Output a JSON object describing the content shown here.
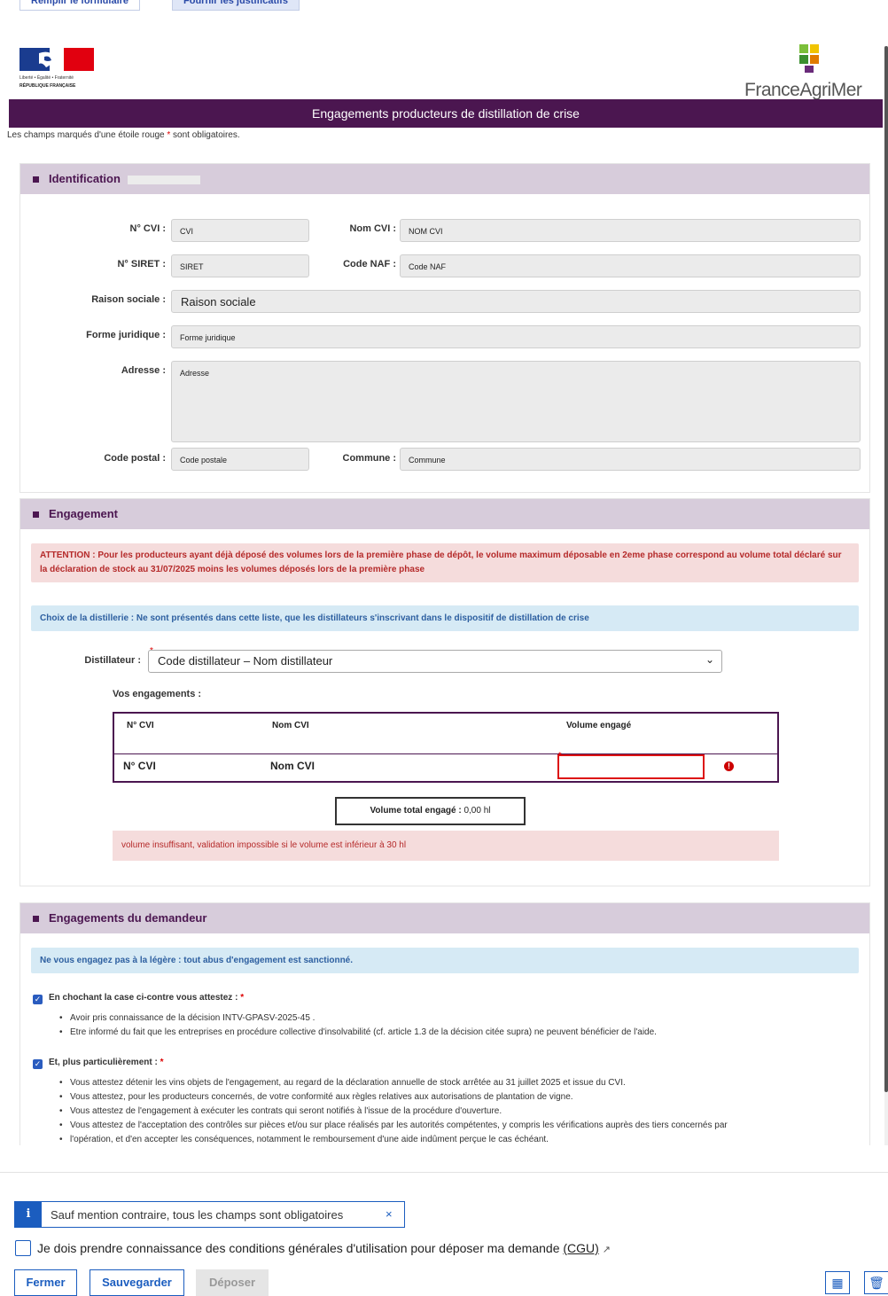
{
  "top_tabs": [
    "Remplir le formulaire",
    "Fournir les justificatifs"
  ],
  "header": {
    "title": "Engagements producteurs de distillation de crise",
    "required_note": "Les champs marqués d'une étoile rouge",
    "required_note_suffix": "sont obligatoires.",
    "logo_left_lines": [
      "Liberté • Égalité • Fraternité",
      "RÉPUBLIQUE FRANÇAISE"
    ],
    "logo_right_text": "FranceAgriMer"
  },
  "identification": {
    "heading": "Identification",
    "labels": {
      "cvi": "N° CVI :",
      "nom_cvi": "Nom CVI :",
      "siret": "N° SIRET :",
      "code_naf": "Code NAF :",
      "raison": "Raison sociale :",
      "forme": "Forme juridique :",
      "adresse": "Adresse :",
      "cp": "Code postal :",
      "commune": "Commune :"
    },
    "values": {
      "cvi": "CVI",
      "nom_cvi": "NOM CVI",
      "siret": "SIRET",
      "code_naf": "Code NAF",
      "raison": "Raison sociale",
      "forme": "Forme juridique",
      "adresse": "Adresse",
      "cp": "Code postale",
      "commune": "Commune"
    }
  },
  "engagement": {
    "heading": "Engagement",
    "attention": "ATTENTION : Pour les producteurs ayant déjà déposé des volumes lors de la première phase de dépôt, le volume maximum déposable en 2eme phase correspond au volume total déclaré sur la déclaration de stock au 31/07/2025 moins les volumes déposés lors de la première phase",
    "choix": "Choix de la distillerie : Ne sont présentés dans cette liste, que les distillateurs s'inscrivant dans le dispositif de distillation de crise",
    "distillateur_label": "Distillateur :",
    "distillateur_value": "Code distillateur – Nom distillateur",
    "vos_engagements": "Vos engagements :",
    "table_headers": [
      "N° CVI",
      "Nom CVI",
      "Volume engagé"
    ],
    "row": {
      "cvi": "N° CVI",
      "nom": "Nom CVI",
      "volume": ""
    },
    "total_label": "Volume total engagé :",
    "total_value": "0,00 hl",
    "insufficient": "volume insuffisant, validation impossible si le volume est inférieur à 30 hl"
  },
  "demandeur": {
    "heading": "Engagements du demandeur",
    "warning": "Ne vous engagez pas à la légère : tout abus d'engagement est sanctionné.",
    "check1_label": "En chochant la case ci-contre vous attestez :",
    "check1_items": [
      "Avoir pris connaissance de la décision INTV-GPASV-2025-45 .",
      "Etre informé du fait que les entreprises en procédure collective d'insolvabilité (cf. article 1.3 de la décision citée supra) ne peuvent bénéficier de l'aide."
    ],
    "check2_label": "Et, plus particulièrement :",
    "check2_items": [
      "Vous attestez détenir les vins objets de l'engagement, au regard de la déclaration annuelle de stock arrêtée au 31 juillet 2025 et issue du CVI.",
      "Vous attestez, pour les producteurs concernés, de votre conformité aux règles relatives aux autorisations de plantation de vigne.",
      "Vous attestez de l'engagement à exécuter les contrats qui seront notifiés à l'issue de la procédure d'ouverture.",
      "Vous attestez de l'acceptation des contrôles sur pièces et/ou sur place réalisés par les autorités compétentes, y compris les vérifications auprès des tiers concernés par",
      "l'opération, et d'en accepter les conséquences, notamment le remboursement d'une aide indûment perçue le cas échéant."
    ]
  },
  "footer": {
    "info": "Sauf mention contraire, tous les champs sont obligatoires",
    "close": "×",
    "cgu_prefix": "Je dois prendre connaissance des conditions générales d'utilisation pour déposer ma demande",
    "cgu_link": "(CGU)",
    "buttons": {
      "fermer": "Fermer",
      "sauvegarder": "Sauvegarder",
      "deposer": "Déposer"
    }
  },
  "colors": {
    "brand": "#4b1650",
    "section_bg": "#d7ccdb",
    "primary": "#1b5dbf",
    "error": "#d11111"
  }
}
